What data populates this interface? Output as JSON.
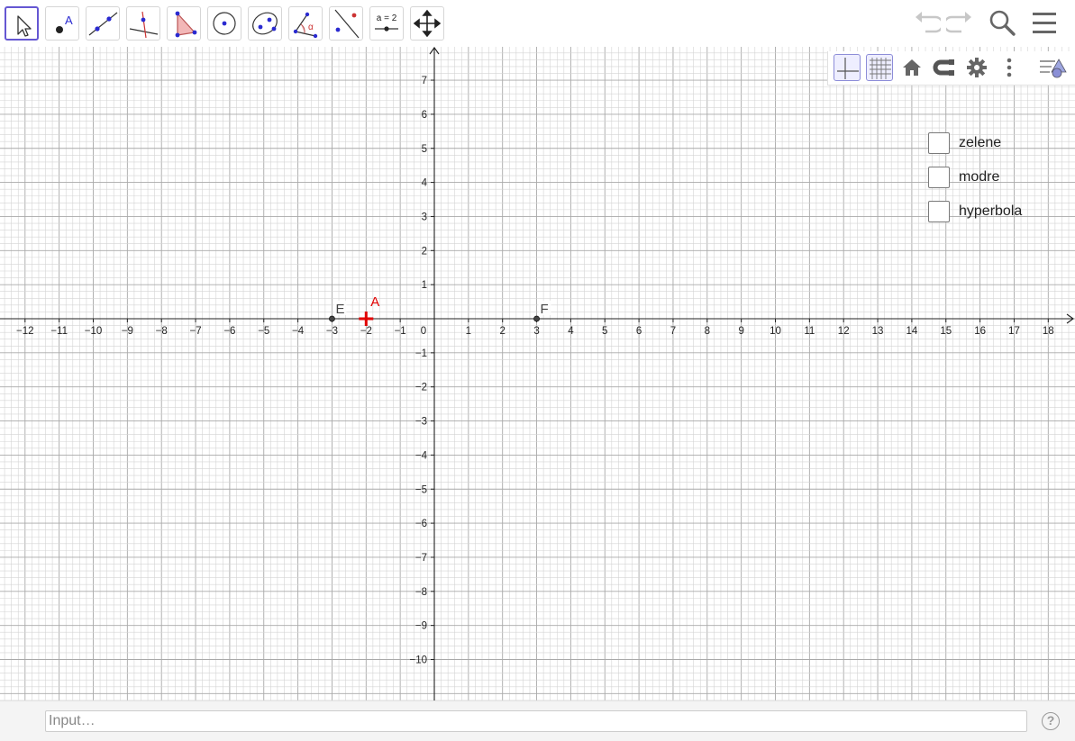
{
  "toolbar": {
    "tools": [
      {
        "name": "move-tool-icon",
        "active": true
      },
      {
        "name": "point-tool-icon",
        "label": "A"
      },
      {
        "name": "line-tool-icon"
      },
      {
        "name": "perpendicular-line-tool-icon"
      },
      {
        "name": "polygon-tool-icon"
      },
      {
        "name": "circle-center-point-tool-icon"
      },
      {
        "name": "ellipse-tool-icon"
      },
      {
        "name": "angle-tool-icon",
        "label": "α"
      },
      {
        "name": "reflect-tool-icon"
      },
      {
        "name": "slider-tool-icon",
        "label": "a = 2"
      },
      {
        "name": "move-graphics-view-tool-icon"
      }
    ],
    "right_icons": [
      "undo-icon",
      "redo-icon",
      "search-icon",
      "menu-icon"
    ]
  },
  "graphics": {
    "x_ticks": [
      "−12",
      "−11",
      "−10",
      "−9",
      "−8",
      "−7",
      "−6",
      "−5",
      "−4",
      "−3",
      "−2",
      "−1",
      "0",
      "1",
      "2",
      "3",
      "4",
      "5",
      "6",
      "7",
      "8",
      "9",
      "10",
      "11",
      "12",
      "13",
      "14",
      "15",
      "16",
      "17",
      "18"
    ],
    "y_ticks_pos": [
      "1",
      "2",
      "3",
      "4",
      "5",
      "6",
      "7"
    ],
    "y_ticks_neg": [
      "−1",
      "−2",
      "−3",
      "−4",
      "−5",
      "−6",
      "−7",
      "−8",
      "−9",
      "−10"
    ],
    "points": [
      {
        "label": "E",
        "x": -3,
        "y": 0,
        "color": "#444444"
      },
      {
        "label": "F",
        "x": 3,
        "y": 0,
        "color": "#444444"
      },
      {
        "label": "A",
        "x": -2,
        "y": 0,
        "color": "#e00000"
      }
    ]
  },
  "style_bar": {
    "icons": [
      "show-axes-icon",
      "show-grid-icon",
      "standard-view-home-icon",
      "point-capturing-icon",
      "graphics-settings-gear-icon",
      "more-options-icon",
      "toggle-style-bar-icon"
    ]
  },
  "checkboxes": [
    {
      "label": "zelene",
      "checked": false
    },
    {
      "label": "modre",
      "checked": false
    },
    {
      "label": "hyperbola",
      "checked": false
    }
  ],
  "input_bar": {
    "placeholder": "Input…",
    "help_label": "?"
  },
  "colors": {
    "accent": "#6557d2",
    "point_A": "#e00000",
    "grid_minor": "#d4d4d4",
    "grid_major": "#a9a9a9"
  }
}
